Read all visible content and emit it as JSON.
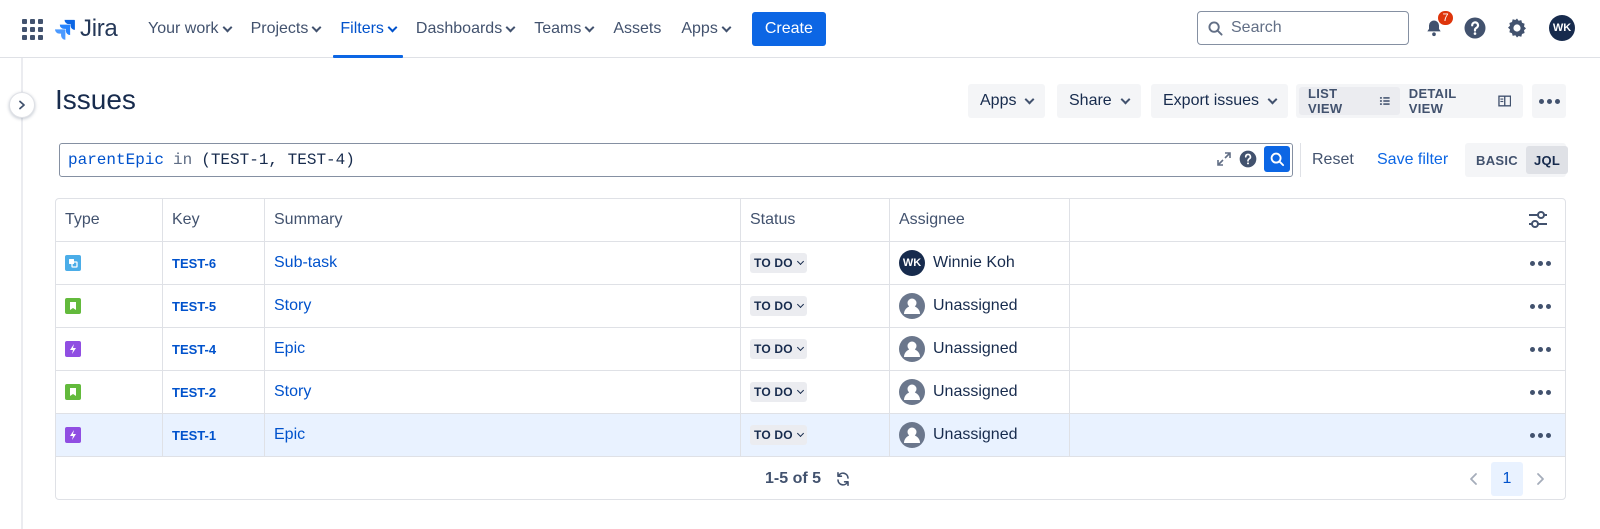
{
  "nav": {
    "logo_text": "Jira",
    "items": [
      {
        "label": "Your work",
        "dropdown": true
      },
      {
        "label": "Projects",
        "dropdown": true
      },
      {
        "label": "Filters",
        "dropdown": true,
        "active": true
      },
      {
        "label": "Dashboards",
        "dropdown": true
      },
      {
        "label": "Teams",
        "dropdown": true
      },
      {
        "label": "Assets",
        "dropdown": false
      },
      {
        "label": "Apps",
        "dropdown": true
      }
    ],
    "create_label": "Create",
    "search_placeholder": "Search",
    "notification_count": "7",
    "user_initials": "WK"
  },
  "page": {
    "title": "Issues",
    "apps_label": "Apps",
    "share_label": "Share",
    "export_label": "Export issues",
    "list_view_label": "LIST VIEW",
    "detail_view_label": "DETAIL VIEW"
  },
  "query": {
    "field": "parentEpic",
    "operator": "in",
    "value": "(TEST-1, TEST-4)",
    "reset_label": "Reset",
    "save_filter_label": "Save filter",
    "basic_label": "BASIC",
    "jql_label": "JQL"
  },
  "table": {
    "columns": [
      "Type",
      "Key",
      "Summary",
      "Status",
      "Assignee"
    ],
    "rows": [
      {
        "type": "subtask",
        "key": "TEST-6",
        "summary": "Sub-task",
        "status": "TO DO",
        "assignee": "Winnie Koh",
        "assignee_initials": "WK",
        "selected": false
      },
      {
        "type": "story",
        "key": "TEST-5",
        "summary": "Story",
        "status": "TO DO",
        "assignee": "Unassigned",
        "assignee_initials": "",
        "selected": false
      },
      {
        "type": "epic",
        "key": "TEST-4",
        "summary": "Epic",
        "status": "TO DO",
        "assignee": "Unassigned",
        "assignee_initials": "",
        "selected": false
      },
      {
        "type": "story",
        "key": "TEST-2",
        "summary": "Story",
        "status": "TO DO",
        "assignee": "Unassigned",
        "assignee_initials": "",
        "selected": false
      },
      {
        "type": "epic",
        "key": "TEST-1",
        "summary": "Epic",
        "status": "TO DO",
        "assignee": "Unassigned",
        "assignee_initials": "",
        "selected": true
      }
    ],
    "count_text": "1-5 of 5",
    "current_page": "1"
  },
  "colors": {
    "accent": "#0c66e4",
    "link": "#0052cc",
    "story": "#63ba3c",
    "epic": "#904ee2",
    "subtask": "#4bade8",
    "selected_row": "#e9f2ff"
  }
}
